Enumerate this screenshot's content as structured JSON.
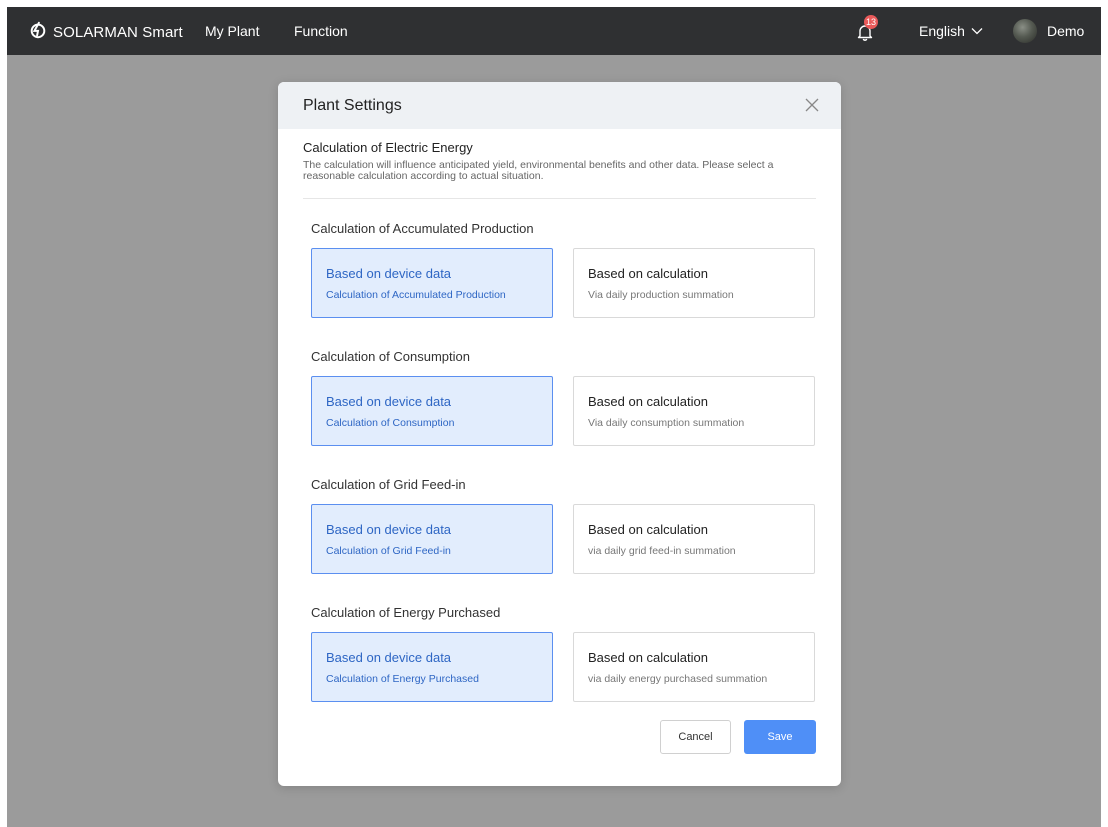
{
  "navbar": {
    "brand": "SOLARMAN Smart",
    "items": [
      {
        "label": "My Plant"
      },
      {
        "label": "Function"
      }
    ],
    "notification_count": "13",
    "language": "English",
    "user": "Demo"
  },
  "modal": {
    "title": "Plant Settings",
    "section": {
      "title": "Calculation of Electric Energy",
      "description": "The calculation will influence anticipated yield, environmental benefits and other data. Please select a reasonable calculation according to actual situation."
    },
    "groups": [
      {
        "title": "Calculation of Accumulated Production",
        "options": [
          {
            "title": "Based on device  data",
            "desc": "Calculation of Accumulated Production",
            "selected": true
          },
          {
            "title": "Based on calculation",
            "desc": "Via daily production summation",
            "selected": false
          }
        ]
      },
      {
        "title": "Calculation of Consumption",
        "options": [
          {
            "title": "Based on device  data",
            "desc": "Calculation of Consumption",
            "selected": true
          },
          {
            "title": "Based on calculation",
            "desc": "Via daily consumption summation",
            "selected": false
          }
        ]
      },
      {
        "title": "Calculation of Grid Feed-in",
        "options": [
          {
            "title": "Based on device  data",
            "desc": "Calculation of Grid Feed-in",
            "selected": true
          },
          {
            "title": "Based on calculation",
            "desc": "via daily grid feed-in summation",
            "selected": false
          }
        ]
      },
      {
        "title": "Calculation of Energy Purchased",
        "options": [
          {
            "title": "Based on device  data",
            "desc": "Calculation of Energy Purchased",
            "selected": true
          },
          {
            "title": "Based on calculation",
            "desc": "via daily energy purchased summation",
            "selected": false
          }
        ]
      }
    ],
    "buttons": {
      "cancel": "Cancel",
      "save": "Save"
    }
  },
  "colors": {
    "navbar": "#2f3032",
    "overlay": "#9b9b9b",
    "accent": "#4f8ff7",
    "selected_bg": "#e2edfd",
    "badge": "#e95a5a"
  },
  "icons": [
    "solarman-logo-icon",
    "bell-icon",
    "chevron-down-icon",
    "close-icon"
  ]
}
